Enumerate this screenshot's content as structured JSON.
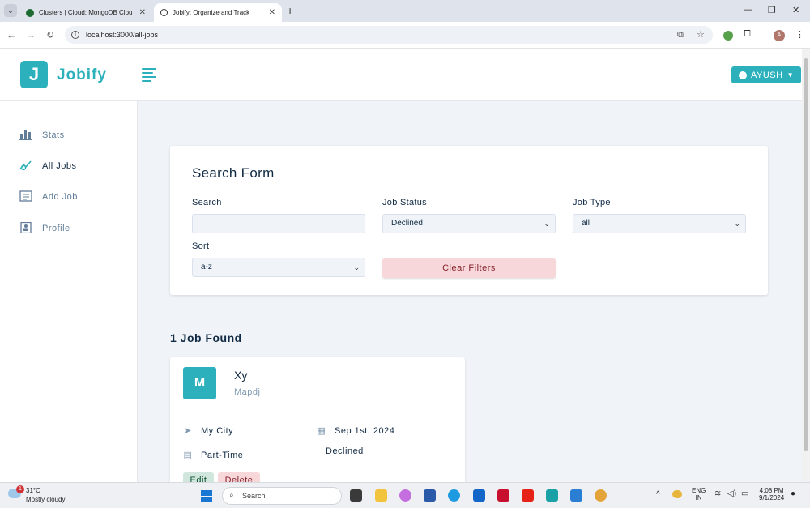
{
  "browser": {
    "tabs": [
      {
        "title": "Clusters | Cloud: MongoDB Clou",
        "active": false
      },
      {
        "title": "Jobify: Organize and Track",
        "active": true
      }
    ],
    "url": "localhost:3000/all-jobs"
  },
  "app": {
    "logo_letter": "J",
    "logo_text": "Jobify",
    "user_label": "AYUSH",
    "accent": "#2cb1bc",
    "sidebar": [
      {
        "label": "Stats",
        "icon": "stats-chart-icon"
      },
      {
        "label": "All Jobs",
        "icon": "query-stats-icon",
        "active": true
      },
      {
        "label": "Add Job",
        "icon": "form-icon"
      },
      {
        "label": "Profile",
        "icon": "profile-card-icon"
      }
    ],
    "search_form": {
      "title": "Search Form",
      "search_label": "Search",
      "search_value": "",
      "status_label": "Job Status",
      "status_value": "Declined",
      "type_label": "Job Type",
      "type_value": "all",
      "sort_label": "Sort",
      "sort_value": "a-z",
      "clear_label": "Clear Filters"
    },
    "jobs_found": "1 Job Found",
    "jobs": [
      {
        "avatar": "M",
        "position": "Xy",
        "company": "Mapdj",
        "location": "My City",
        "date": "Sep 1st, 2024",
        "type": "Part-Time",
        "status": "Declined",
        "edit_label": "Edit",
        "delete_label": "Delete"
      }
    ]
  },
  "taskbar": {
    "temp": "31°C",
    "weather": "Mostly cloudy",
    "weather_badge": "1",
    "search_placeholder": "Search",
    "lang_top": "ENG",
    "lang_bottom": "IN",
    "time": "4:08 PM",
    "date": "9/1/2024"
  }
}
